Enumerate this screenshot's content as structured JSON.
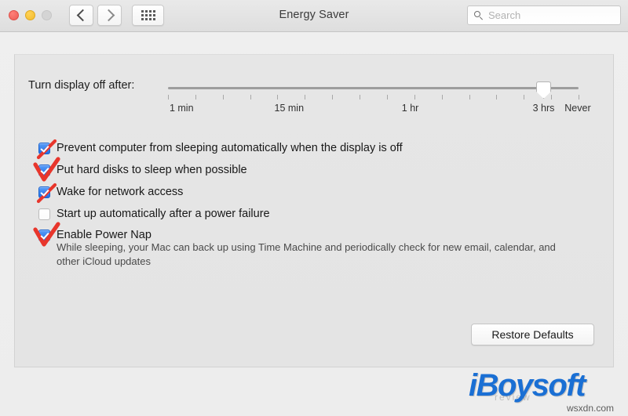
{
  "window": {
    "title": "Energy Saver",
    "traffic_lights": [
      "close",
      "minimize",
      "zoom"
    ],
    "nav": {
      "back_label": "Back",
      "forward_label": "Forward",
      "grid_label": "Show All"
    },
    "search": {
      "placeholder": "Search",
      "value": ""
    }
  },
  "slider": {
    "label": "Turn display off after:",
    "tick_labels": [
      {
        "text": "1 min",
        "pos_pct": 3.3
      },
      {
        "text": "15 min",
        "pos_pct": 29.5
      },
      {
        "text": "1 hr",
        "pos_pct": 59.0
      },
      {
        "text": "3 hrs",
        "pos_pct": 91.5
      },
      {
        "text": "Never",
        "pos_pct": 99.8
      }
    ],
    "tick_count": 16,
    "value_label": "3 hrs",
    "thumb_pos_pct": 91.5
  },
  "options": [
    {
      "label": "Prevent computer from sleeping automatically when the display is off",
      "checked": true,
      "annotation": "slash"
    },
    {
      "label": "Put hard disks to sleep when possible",
      "checked": true,
      "annotation": "check"
    },
    {
      "label": "Wake for network access",
      "checked": true,
      "annotation": "slash"
    },
    {
      "label": "Start up automatically after a power failure",
      "checked": false,
      "annotation": "none"
    },
    {
      "label": "Enable Power Nap",
      "checked": true,
      "annotation": "check"
    }
  ],
  "power_nap_description": "While sleeping, your Mac can back up using Time Machine and periodically check for new email, calendar, and other iCloud updates",
  "buttons": {
    "restore_defaults": "Restore Defaults"
  },
  "watermark": {
    "logo": "iBoysoft",
    "site": "wsxdn.com",
    "ghost": "review"
  },
  "colors": {
    "accent_blue": "#1f6fe5",
    "annotation_red": "#e8362c",
    "logo_blue": "#1a6fd4",
    "titlebar": "#e3e3e3",
    "panel": "#e5e5e5"
  }
}
